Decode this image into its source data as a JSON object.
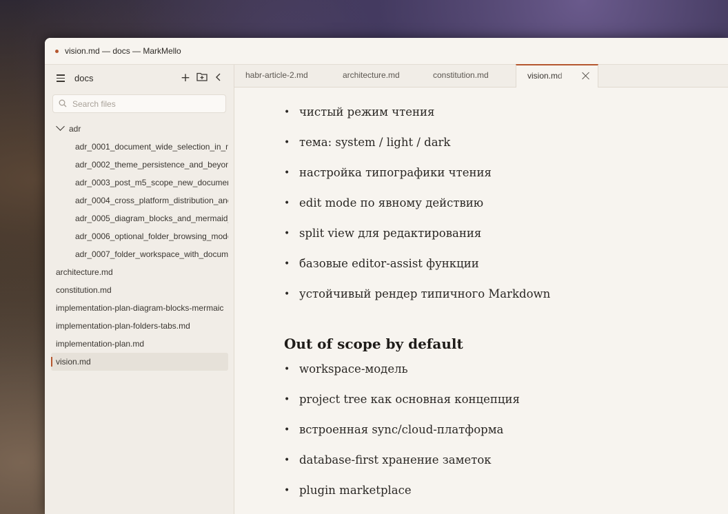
{
  "window": {
    "title": "vision.md — docs — MarkMello"
  },
  "sidebar": {
    "title": "docs",
    "search_placeholder": "Search files",
    "folder": {
      "name": "adr",
      "children": [
        "adr_0001_document_wide_selection_in_m",
        "adr_0002_theme_persistence_and_beyon",
        "adr_0003_post_m5_scope_new_documer",
        "adr_0004_cross_platform_distribution_anc",
        "adr_0005_diagram_blocks_and_mermaid_",
        "adr_0006_optional_folder_browsing_mode",
        "adr_0007_folder_workspace_with_docume"
      ]
    },
    "files": [
      "architecture.md",
      "constitution.md",
      "implementation-plan-diagram-blocks-mermaic",
      "implementation-plan-folders-tabs.md",
      "implementation-plan.md",
      "vision.md"
    ],
    "active_file": "vision.md"
  },
  "tabs": [
    {
      "label": "habr-article-2.md"
    },
    {
      "label": "architecture.md"
    },
    {
      "label": "constitution.md"
    },
    {
      "label": "vision.md",
      "active": true
    }
  ],
  "content": {
    "list1": [
      "чистый режим чтения",
      "тема: system / light / dark",
      "настройка типографики чтения",
      "edit mode по явному действию",
      "split view для редактирования",
      "базовые editor-assist функции",
      "устойчивый рендер типичного Markdown"
    ],
    "heading": "Out of scope by default",
    "list2": [
      "workspace-модель",
      "project tree как основная концепция",
      "встроенная sync/cloud-платформа",
      "database-first хранение заметок",
      "plugin marketplace"
    ]
  },
  "colors": {
    "accent": "#b5562e",
    "background": "#f7f4ef",
    "sidebar": "#f1ede7"
  },
  "icons": [
    "menu-icon",
    "plus-icon",
    "new-folder-icon",
    "collapse-chevron-icon",
    "search-icon",
    "close-icon"
  ]
}
